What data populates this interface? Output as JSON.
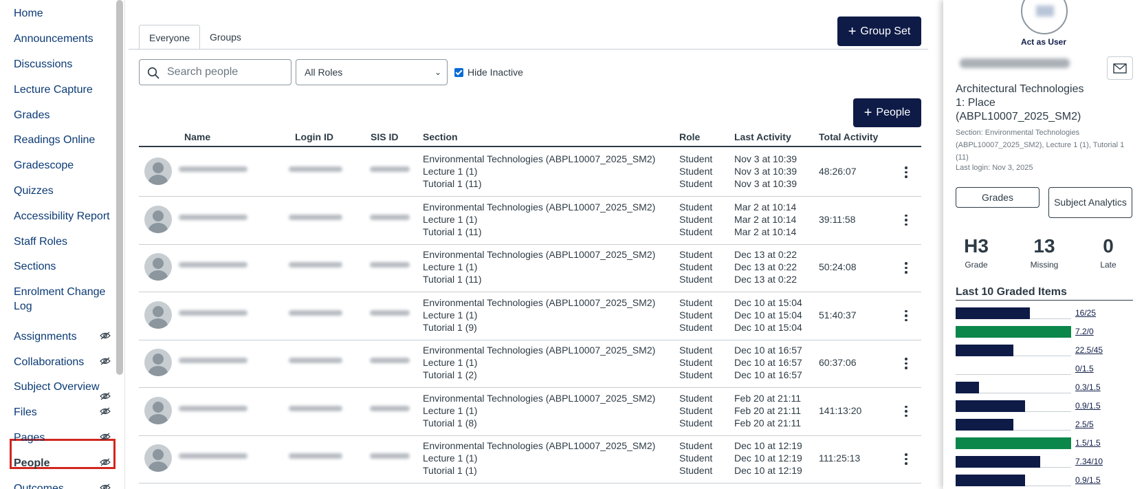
{
  "nav": {
    "items": [
      {
        "label": "Home",
        "hidden": false
      },
      {
        "label": "Announcements",
        "hidden": false
      },
      {
        "label": "Discussions",
        "hidden": false
      },
      {
        "label": "Lecture Capture",
        "hidden": false
      },
      {
        "label": "Grades",
        "hidden": false
      },
      {
        "label": "Readings Online",
        "hidden": false
      },
      {
        "label": "Gradescope",
        "hidden": false
      },
      {
        "label": "Quizzes",
        "hidden": false
      },
      {
        "label": "Accessibility Report",
        "hidden": false
      },
      {
        "label": "Staff Roles",
        "hidden": false
      },
      {
        "label": "Sections",
        "hidden": false
      },
      {
        "label": "Enrolment Change Log",
        "hidden": false
      },
      {
        "label": "Assignments",
        "hidden": true
      },
      {
        "label": "Collaborations",
        "hidden": true
      },
      {
        "label": "Subject Overview",
        "hidden": true
      },
      {
        "label": "Files",
        "hidden": true
      },
      {
        "label": "Pages",
        "hidden": true
      },
      {
        "label": "People",
        "hidden": true,
        "active": true
      },
      {
        "label": "Outcomes",
        "hidden": true
      }
    ]
  },
  "tabs": [
    {
      "label": "Everyone",
      "active": true
    },
    {
      "label": "Groups",
      "active": false
    }
  ],
  "buttons": {
    "group_set": "Group Set",
    "people": "People"
  },
  "search": {
    "placeholder": "Search people"
  },
  "role_filter": {
    "selected": "All Roles"
  },
  "hide_inactive": {
    "label": "Hide Inactive",
    "checked": true
  },
  "table": {
    "headers": [
      "Name",
      "Login ID",
      "SIS ID",
      "Section",
      "Role",
      "Last Activity",
      "Total Activity"
    ],
    "rows": [
      {
        "sections": [
          "Environmental Technologies (ABPL10007_2025_SM2)",
          "Lecture 1 (1)",
          "Tutorial 1 (11)"
        ],
        "roles": [
          "Student",
          "Student",
          "Student"
        ],
        "last_activity": [
          "Nov 3 at 10:39",
          "Nov 3 at 10:39",
          "Nov 3 at 10:39"
        ],
        "total_activity": "48:26:07"
      },
      {
        "sections": [
          "Environmental Technologies (ABPL10007_2025_SM2)",
          "Lecture 1 (1)",
          "Tutorial 1 (11)"
        ],
        "roles": [
          "Student",
          "Student",
          "Student"
        ],
        "last_activity": [
          "Mar 2 at 10:14",
          "Mar 2 at 10:14",
          "Mar 2 at 10:14"
        ],
        "total_activity": "39:11:58"
      },
      {
        "sections": [
          "Environmental Technologies (ABPL10007_2025_SM2)",
          "Lecture 1 (1)",
          "Tutorial 1 (11)"
        ],
        "roles": [
          "Student",
          "Student",
          "Student"
        ],
        "last_activity": [
          "Dec 13 at 0:22",
          "Dec 13 at 0:22",
          "Dec 13 at 0:22"
        ],
        "total_activity": "50:24:08"
      },
      {
        "sections": [
          "Environmental Technologies (ABPL10007_2025_SM2)",
          "Lecture 1 (1)",
          "Tutorial 1 (9)"
        ],
        "roles": [
          "Student",
          "Student",
          "Student"
        ],
        "last_activity": [
          "Dec 10 at 15:04",
          "Dec 10 at 15:04",
          "Dec 10 at 15:04"
        ],
        "total_activity": "51:40:37"
      },
      {
        "sections": [
          "Environmental Technologies (ABPL10007_2025_SM2)",
          "Lecture 1 (1)",
          "Tutorial 1 (2)"
        ],
        "roles": [
          "Student",
          "Student",
          "Student"
        ],
        "last_activity": [
          "Dec 10 at 16:57",
          "Dec 10 at 16:57",
          "Dec 10 at 16:57"
        ],
        "total_activity": "60:37:06"
      },
      {
        "sections": [
          "Environmental Technologies (ABPL10007_2025_SM2)",
          "Lecture 1 (1)",
          "Tutorial 1 (8)"
        ],
        "roles": [
          "Student",
          "Student",
          "Student"
        ],
        "last_activity": [
          "Feb 20 at 21:11",
          "Feb 20 at 21:11",
          "Feb 20 at 21:11"
        ],
        "total_activity": "141:13:20"
      },
      {
        "sections": [
          "Environmental Technologies (ABPL10007_2025_SM2)",
          "Lecture 1 (1)",
          "Tutorial 1 (1)"
        ],
        "roles": [
          "Student",
          "Student",
          "Student"
        ],
        "last_activity": [
          "Dec 10 at 12:19",
          "Dec 10 at 12:19",
          "Dec 10 at 12:19"
        ],
        "total_activity": "111:25:13"
      }
    ]
  },
  "tray": {
    "act_as": "Act as User",
    "course": "Architectural Technologies 1: Place (ABPL10007_2025_SM2)",
    "section": "Section: Environmental Technologies (ABPL10007_2025_SM2), Lecture 1 (1), Tutorial 1 (11)",
    "last_login": "Last login: Nov 3, 2025",
    "grades_button": "Grades",
    "analytics_button": "Subject Analytics",
    "stats": [
      {
        "value": "H3",
        "label": "Grade"
      },
      {
        "value": "13",
        "label": "Missing"
      },
      {
        "value": "0",
        "label": "Late"
      }
    ],
    "last10_title": "Last 10 Graded Items",
    "graded_items": [
      {
        "label": "16/25",
        "fraction": 0.64,
        "color": "#0e1b47"
      },
      {
        "label": "7.2/0",
        "fraction": 1.0,
        "color": "#0b874b"
      },
      {
        "label": "22.5/45",
        "fraction": 0.5,
        "color": "#0e1b47"
      },
      {
        "label": "0/1.5",
        "fraction": 0.0,
        "color": "#0e1b47"
      },
      {
        "label": "0.3/1.5",
        "fraction": 0.2,
        "color": "#0e1b47"
      },
      {
        "label": "0.9/1.5",
        "fraction": 0.6,
        "color": "#0e1b47"
      },
      {
        "label": "2.5/5",
        "fraction": 0.5,
        "color": "#0e1b47"
      },
      {
        "label": "1.5/1.5",
        "fraction": 1.0,
        "color": "#0b874b"
      },
      {
        "label": "7.34/10",
        "fraction": 0.734,
        "color": "#0e1b47"
      },
      {
        "label": "0.9/1.5",
        "fraction": 0.6,
        "color": "#0e1b47"
      }
    ]
  },
  "colors": {
    "brand": "#0e1b47",
    "link": "#0b3a75",
    "active_outline": "#d1261d",
    "success": "#0b874b"
  }
}
